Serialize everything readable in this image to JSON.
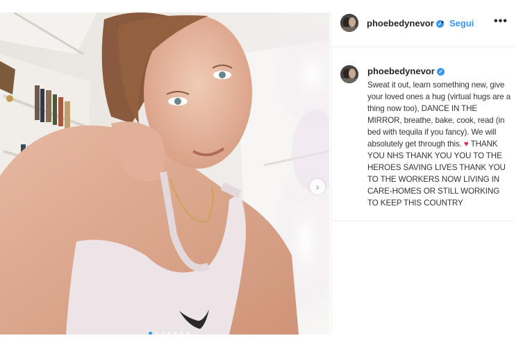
{
  "post": {
    "username": "phoebedynevor",
    "follow_label": "Segui",
    "bullet": "•",
    "more_label": "•••",
    "verified_glyph": "✓",
    "next_glyph": "›",
    "carousel": {
      "total": 7,
      "active": 1
    },
    "caption": {
      "before_heart": "Sweat it out, learn something new, give your loved ones a hug (virtual hugs are a thing now too), DANCE IN THE MIRROR, breathe, bake, cook, read (in bed with tequila if you fancy). We will absolutely get through this. ",
      "heart": "♥",
      "after_heart": " THANK YOU NHS THANK YOU YOU TO THE HEROES SAVING LIVES THANK YOU TO THE WORKERS NOW LIVING IN CARE-HOMES OR STILL WORKING TO KEEP THIS COUNTRY"
    }
  },
  "colors": {
    "accent": "#3897f0",
    "heart": "#e0245e",
    "border": "#efefef"
  },
  "icons": {
    "verified": "verified-badge-icon",
    "next": "chevron-right-icon",
    "more": "more-options-icon"
  }
}
